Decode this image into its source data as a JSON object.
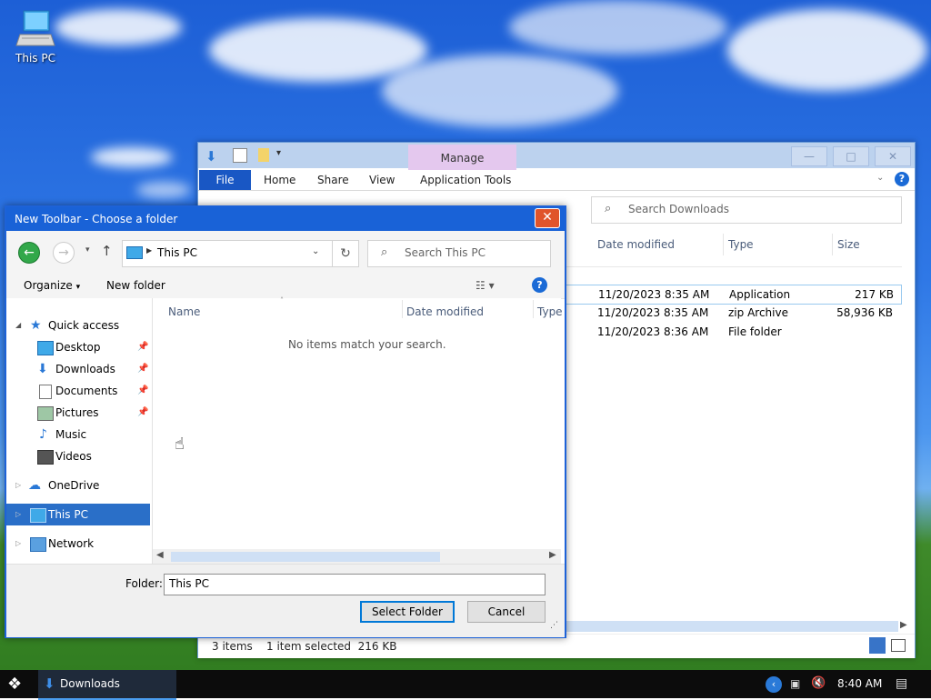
{
  "desktop": {
    "icon_label": "This PC"
  },
  "explorer": {
    "manage_tab": "Manage",
    "ribbon_tabs": [
      "File",
      "Home",
      "Share",
      "View",
      "Application Tools"
    ],
    "search_placeholder": "Search Downloads",
    "columns": [
      "Date modified",
      "Type",
      "Size"
    ],
    "rows": [
      {
        "date": "11/20/2023 8:35 AM",
        "type": "Application",
        "size": "217 KB"
      },
      {
        "date": "11/20/2023 8:35 AM",
        "type": "zip Archive",
        "size": "58,936 KB"
      },
      {
        "date": "11/20/2023 8:36 AM",
        "type": "File folder",
        "size": ""
      }
    ],
    "status_items": "3 items",
    "status_selected": "1 item selected  216 KB"
  },
  "dialog": {
    "title": "New Toolbar - Choose a folder",
    "address": "This PC",
    "search_placeholder": "Search This PC",
    "organize_label": "Organize",
    "new_folder_label": "New folder",
    "nav": {
      "quick_access": "Quick access",
      "items": [
        {
          "label": "Desktop",
          "pinned": true
        },
        {
          "label": "Downloads",
          "pinned": true
        },
        {
          "label": "Documents",
          "pinned": true
        },
        {
          "label": "Pictures",
          "pinned": true
        },
        {
          "label": "Music",
          "pinned": false
        },
        {
          "label": "Videos",
          "pinned": false
        }
      ],
      "onedrive": "OneDrive",
      "this_pc": "This PC",
      "network": "Network"
    },
    "columns": [
      "Name",
      "Date modified",
      "Type"
    ],
    "empty_message": "No items match your search.",
    "folder_label": "Folder:",
    "folder_value": "This PC",
    "select_button": "Select Folder",
    "cancel_button": "Cancel"
  },
  "taskbar": {
    "app_label": "Downloads",
    "time": "8:40 AM"
  },
  "colors": {
    "dialog_title_bg": "#1962d7",
    "selection_bg": "#cce8ff",
    "file_tab_bg": "#1957c4",
    "manage_tab_bg": "#e4c8ee"
  }
}
